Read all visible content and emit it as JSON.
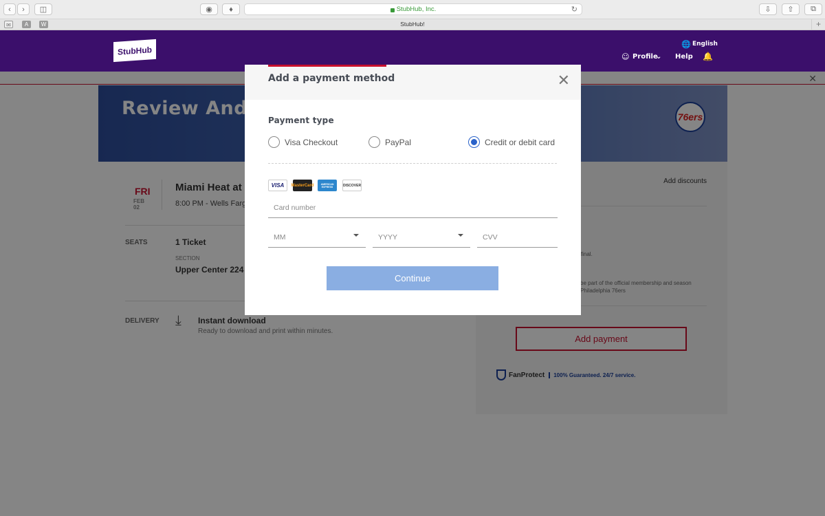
{
  "browser": {
    "address": "StubHub, Inc.",
    "tab_title": "StubHub!",
    "fav_a": "A",
    "fav_w": "W"
  },
  "header": {
    "logo": "StubHub",
    "language": "English",
    "profile": "Profile",
    "help": "Help"
  },
  "banner": {
    "title": "Review And Buy",
    "team_logo": "76ers"
  },
  "event": {
    "dow": "FRI",
    "date": "FEB 02",
    "name": "Miami Heat at P",
    "time": "8:00 PM - Wells Farg"
  },
  "seats": {
    "label": "SEATS",
    "count": "1 Ticket",
    "section_label": "SECTION",
    "section": "Upper Center 224"
  },
  "delivery": {
    "label": "DELIVERY",
    "method": "Instant download",
    "sub": "Ready to download and print within minutes."
  },
  "side": {
    "add_discounts": "Add discounts",
    "note1": "r is final.",
    "note2a": "be part of the official membership and season",
    "note2b": "Philadelphia 76ers",
    "add_payment": "Add payment",
    "fanprotect": "FanProtect",
    "fanprotect_tag": "100% Guaranteed. 24/7 service."
  },
  "modal": {
    "title": "Add a payment method",
    "payment_type": "Payment type",
    "options": [
      "Visa Checkout",
      "PayPal",
      "Credit or debit card"
    ],
    "selected": "Credit or debit card",
    "cards": [
      "VISA",
      "MasterCard",
      "AMERICAN EXPRESS",
      "DISCOVER"
    ],
    "card_number_placeholder": "Card number",
    "month_placeholder": "MM",
    "year_placeholder": "YYYY",
    "cvv_placeholder": "CVV",
    "continue": "Continue"
  },
  "colors": {
    "brand_purple": "#3b0f6b",
    "accent_red": "#c8102e",
    "radio_blue": "#2a62c9",
    "continue_disabled": "#8aaee2"
  }
}
